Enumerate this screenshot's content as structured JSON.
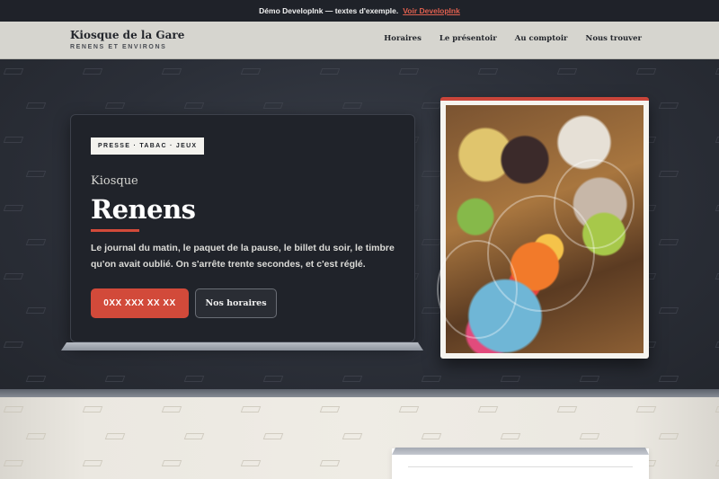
{
  "demo_bar": {
    "text": "Démo DevelopInk — textes d'exemple.",
    "link_label": "Voir DevelopInk"
  },
  "header": {
    "brand_name": "Kiosque de la Gare",
    "brand_sub": "RENENS ET ENVIRONS",
    "nav": [
      "Horaires",
      "Le présentoir",
      "Au comptoir",
      "Nous trouver"
    ]
  },
  "hero": {
    "tag": "PRESSE · TABAC · JEUX",
    "eyebrow": "Kiosque",
    "title": "Renens",
    "text": "Le journal du matin, le paquet de la pause, le billet du soir, le timbre qu'on avait oublié. On s'arrête trente secondes, et c'est réglé.",
    "phone_button": "0XX XXX XX XX",
    "hours_button": "Nos horaires"
  },
  "colors": {
    "accent": "#d24a3a",
    "dark_bg": "#2a2e37",
    "header_bg": "#d6d5cf",
    "lower_bg": "#efece5"
  },
  "icons": {
    "photo": "candy-jars-photo"
  }
}
